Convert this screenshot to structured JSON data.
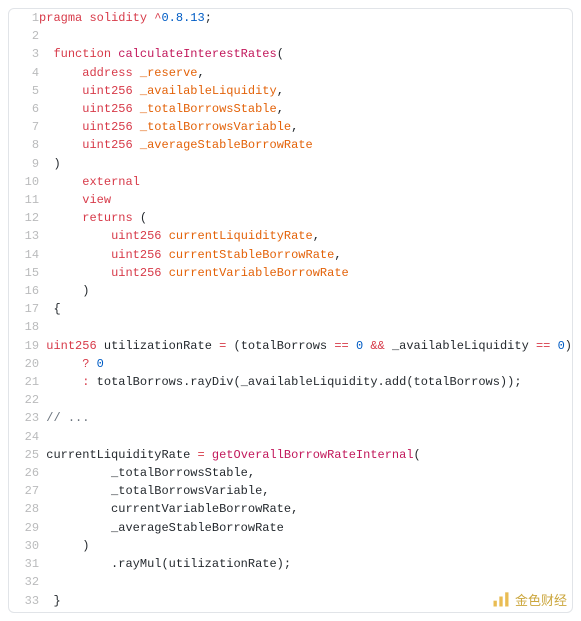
{
  "code": {
    "lines": [
      {
        "n": 1,
        "tokens": [
          [
            "kw",
            "pragma"
          ],
          [
            "pl",
            " "
          ],
          [
            "kw",
            "solidity"
          ],
          [
            "pl",
            " "
          ],
          [
            "op",
            "^"
          ],
          [
            "num",
            "0.8.13"
          ],
          [
            "pl",
            ";"
          ]
        ]
      },
      {
        "n": 2,
        "tokens": []
      },
      {
        "n": 3,
        "tokens": [
          [
            "pl",
            "  "
          ],
          [
            "kw",
            "function"
          ],
          [
            "pl",
            " "
          ],
          [
            "fn",
            "calculateInterestRates"
          ],
          [
            "pl",
            "("
          ]
        ]
      },
      {
        "n": 4,
        "tokens": [
          [
            "pl",
            "      "
          ],
          [
            "kw",
            "address"
          ],
          [
            "pl",
            " "
          ],
          [
            "id",
            "_reserve"
          ],
          [
            "pl",
            ","
          ]
        ]
      },
      {
        "n": 5,
        "tokens": [
          [
            "pl",
            "      "
          ],
          [
            "kw",
            "uint256"
          ],
          [
            "pl",
            " "
          ],
          [
            "id",
            "_availableLiquidity"
          ],
          [
            "pl",
            ","
          ]
        ]
      },
      {
        "n": 6,
        "tokens": [
          [
            "pl",
            "      "
          ],
          [
            "kw",
            "uint256"
          ],
          [
            "pl",
            " "
          ],
          [
            "id",
            "_totalBorrowsStable"
          ],
          [
            "pl",
            ","
          ]
        ]
      },
      {
        "n": 7,
        "tokens": [
          [
            "pl",
            "      "
          ],
          [
            "kw",
            "uint256"
          ],
          [
            "pl",
            " "
          ],
          [
            "id",
            "_totalBorrowsVariable"
          ],
          [
            "pl",
            ","
          ]
        ]
      },
      {
        "n": 8,
        "tokens": [
          [
            "pl",
            "      "
          ],
          [
            "kw",
            "uint256"
          ],
          [
            "pl",
            " "
          ],
          [
            "id",
            "_averageStableBorrowRate"
          ]
        ]
      },
      {
        "n": 9,
        "tokens": [
          [
            "pl",
            "  )"
          ]
        ]
      },
      {
        "n": 10,
        "tokens": [
          [
            "pl",
            "      "
          ],
          [
            "kw",
            "external"
          ]
        ]
      },
      {
        "n": 11,
        "tokens": [
          [
            "pl",
            "      "
          ],
          [
            "kw",
            "view"
          ]
        ]
      },
      {
        "n": 12,
        "tokens": [
          [
            "pl",
            "      "
          ],
          [
            "kw",
            "returns"
          ],
          [
            "pl",
            " ("
          ]
        ]
      },
      {
        "n": 13,
        "tokens": [
          [
            "pl",
            "          "
          ],
          [
            "kw",
            "uint256"
          ],
          [
            "pl",
            " "
          ],
          [
            "id",
            "currentLiquidityRate"
          ],
          [
            "pl",
            ","
          ]
        ]
      },
      {
        "n": 14,
        "tokens": [
          [
            "pl",
            "          "
          ],
          [
            "kw",
            "uint256"
          ],
          [
            "pl",
            " "
          ],
          [
            "id",
            "currentStableBorrowRate"
          ],
          [
            "pl",
            ","
          ]
        ]
      },
      {
        "n": 15,
        "tokens": [
          [
            "pl",
            "          "
          ],
          [
            "kw",
            "uint256"
          ],
          [
            "pl",
            " "
          ],
          [
            "id",
            "currentVariableBorrowRate"
          ]
        ]
      },
      {
        "n": 16,
        "tokens": [
          [
            "pl",
            "      )"
          ]
        ]
      },
      {
        "n": 17,
        "tokens": [
          [
            "pl",
            "  {"
          ]
        ]
      },
      {
        "n": 18,
        "tokens": []
      },
      {
        "n": 19,
        "tokens": [
          [
            "pl",
            " "
          ],
          [
            "kw",
            "uint256"
          ],
          [
            "pl",
            " utilizationRate "
          ],
          [
            "op",
            "="
          ],
          [
            "pl",
            " (totalBorrows "
          ],
          [
            "op",
            "=="
          ],
          [
            "pl",
            " "
          ],
          [
            "num",
            "0"
          ],
          [
            "pl",
            " "
          ],
          [
            "op",
            "&&"
          ],
          [
            "pl",
            " _availableLiquidity "
          ],
          [
            "op",
            "=="
          ],
          [
            "pl",
            " "
          ],
          [
            "num",
            "0"
          ],
          [
            "pl",
            ")"
          ]
        ]
      },
      {
        "n": 20,
        "tokens": [
          [
            "pl",
            "      "
          ],
          [
            "op",
            "?"
          ],
          [
            "pl",
            " "
          ],
          [
            "num",
            "0"
          ]
        ]
      },
      {
        "n": 21,
        "tokens": [
          [
            "pl",
            "      "
          ],
          [
            "op",
            ":"
          ],
          [
            "pl",
            " totalBorrows.rayDiv(_availableLiquidity.add(totalBorrows));"
          ]
        ]
      },
      {
        "n": 22,
        "tokens": []
      },
      {
        "n": 23,
        "tokens": [
          [
            "pl",
            " "
          ],
          [
            "cm",
            "// ..."
          ]
        ]
      },
      {
        "n": 24,
        "tokens": []
      },
      {
        "n": 25,
        "tokens": [
          [
            "pl",
            " currentLiquidityRate "
          ],
          [
            "op",
            "="
          ],
          [
            "pl",
            " "
          ],
          [
            "fn",
            "getOverallBorrowRateInternal"
          ],
          [
            "pl",
            "("
          ]
        ]
      },
      {
        "n": 26,
        "tokens": [
          [
            "pl",
            "          _totalBorrowsStable,"
          ]
        ]
      },
      {
        "n": 27,
        "tokens": [
          [
            "pl",
            "          _totalBorrowsVariable,"
          ]
        ]
      },
      {
        "n": 28,
        "tokens": [
          [
            "pl",
            "          currentVariableBorrowRate,"
          ]
        ]
      },
      {
        "n": 29,
        "tokens": [
          [
            "pl",
            "          _averageStableBorrowRate"
          ]
        ]
      },
      {
        "n": 30,
        "tokens": [
          [
            "pl",
            "      )"
          ]
        ]
      },
      {
        "n": 31,
        "tokens": [
          [
            "pl",
            "          .rayMul(utilizationRate);"
          ]
        ]
      },
      {
        "n": 32,
        "tokens": []
      },
      {
        "n": 33,
        "tokens": [
          [
            "pl",
            "  }"
          ]
        ]
      }
    ]
  },
  "watermark": {
    "text": "金色财经",
    "icon_stroke": "#e8b94a",
    "icon_bg": "#ffffff"
  }
}
